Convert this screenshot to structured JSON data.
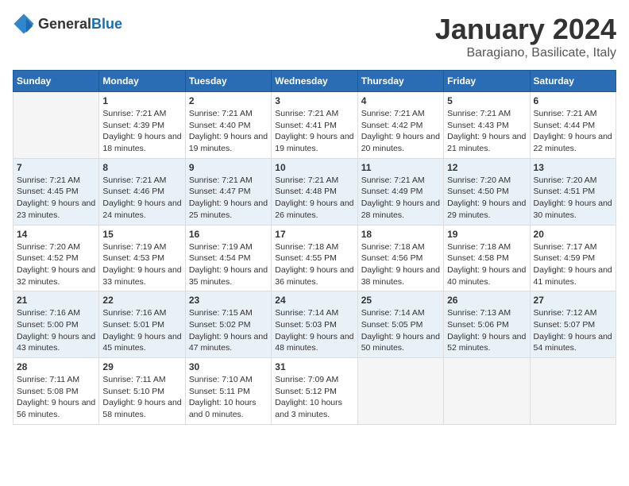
{
  "header": {
    "logo_general": "General",
    "logo_blue": "Blue",
    "main_title": "January 2024",
    "sub_title": "Baragiano, Basilicate, Italy"
  },
  "weekdays": [
    "Sunday",
    "Monday",
    "Tuesday",
    "Wednesday",
    "Thursday",
    "Friday",
    "Saturday"
  ],
  "weeks": [
    [
      {
        "day": "",
        "sunrise": "",
        "sunset": "",
        "daylight": ""
      },
      {
        "day": "1",
        "sunrise": "Sunrise: 7:21 AM",
        "sunset": "Sunset: 4:39 PM",
        "daylight": "Daylight: 9 hours and 18 minutes."
      },
      {
        "day": "2",
        "sunrise": "Sunrise: 7:21 AM",
        "sunset": "Sunset: 4:40 PM",
        "daylight": "Daylight: 9 hours and 19 minutes."
      },
      {
        "day": "3",
        "sunrise": "Sunrise: 7:21 AM",
        "sunset": "Sunset: 4:41 PM",
        "daylight": "Daylight: 9 hours and 19 minutes."
      },
      {
        "day": "4",
        "sunrise": "Sunrise: 7:21 AM",
        "sunset": "Sunset: 4:42 PM",
        "daylight": "Daylight: 9 hours and 20 minutes."
      },
      {
        "day": "5",
        "sunrise": "Sunrise: 7:21 AM",
        "sunset": "Sunset: 4:43 PM",
        "daylight": "Daylight: 9 hours and 21 minutes."
      },
      {
        "day": "6",
        "sunrise": "Sunrise: 7:21 AM",
        "sunset": "Sunset: 4:44 PM",
        "daylight": "Daylight: 9 hours and 22 minutes."
      }
    ],
    [
      {
        "day": "7",
        "sunrise": "Sunrise: 7:21 AM",
        "sunset": "Sunset: 4:45 PM",
        "daylight": "Daylight: 9 hours and 23 minutes."
      },
      {
        "day": "8",
        "sunrise": "Sunrise: 7:21 AM",
        "sunset": "Sunset: 4:46 PM",
        "daylight": "Daylight: 9 hours and 24 minutes."
      },
      {
        "day": "9",
        "sunrise": "Sunrise: 7:21 AM",
        "sunset": "Sunset: 4:47 PM",
        "daylight": "Daylight: 9 hours and 25 minutes."
      },
      {
        "day": "10",
        "sunrise": "Sunrise: 7:21 AM",
        "sunset": "Sunset: 4:48 PM",
        "daylight": "Daylight: 9 hours and 26 minutes."
      },
      {
        "day": "11",
        "sunrise": "Sunrise: 7:21 AM",
        "sunset": "Sunset: 4:49 PM",
        "daylight": "Daylight: 9 hours and 28 minutes."
      },
      {
        "day": "12",
        "sunrise": "Sunrise: 7:20 AM",
        "sunset": "Sunset: 4:50 PM",
        "daylight": "Daylight: 9 hours and 29 minutes."
      },
      {
        "day": "13",
        "sunrise": "Sunrise: 7:20 AM",
        "sunset": "Sunset: 4:51 PM",
        "daylight": "Daylight: 9 hours and 30 minutes."
      }
    ],
    [
      {
        "day": "14",
        "sunrise": "Sunrise: 7:20 AM",
        "sunset": "Sunset: 4:52 PM",
        "daylight": "Daylight: 9 hours and 32 minutes."
      },
      {
        "day": "15",
        "sunrise": "Sunrise: 7:19 AM",
        "sunset": "Sunset: 4:53 PM",
        "daylight": "Daylight: 9 hours and 33 minutes."
      },
      {
        "day": "16",
        "sunrise": "Sunrise: 7:19 AM",
        "sunset": "Sunset: 4:54 PM",
        "daylight": "Daylight: 9 hours and 35 minutes."
      },
      {
        "day": "17",
        "sunrise": "Sunrise: 7:18 AM",
        "sunset": "Sunset: 4:55 PM",
        "daylight": "Daylight: 9 hours and 36 minutes."
      },
      {
        "day": "18",
        "sunrise": "Sunrise: 7:18 AM",
        "sunset": "Sunset: 4:56 PM",
        "daylight": "Daylight: 9 hours and 38 minutes."
      },
      {
        "day": "19",
        "sunrise": "Sunrise: 7:18 AM",
        "sunset": "Sunset: 4:58 PM",
        "daylight": "Daylight: 9 hours and 40 minutes."
      },
      {
        "day": "20",
        "sunrise": "Sunrise: 7:17 AM",
        "sunset": "Sunset: 4:59 PM",
        "daylight": "Daylight: 9 hours and 41 minutes."
      }
    ],
    [
      {
        "day": "21",
        "sunrise": "Sunrise: 7:16 AM",
        "sunset": "Sunset: 5:00 PM",
        "daylight": "Daylight: 9 hours and 43 minutes."
      },
      {
        "day": "22",
        "sunrise": "Sunrise: 7:16 AM",
        "sunset": "Sunset: 5:01 PM",
        "daylight": "Daylight: 9 hours and 45 minutes."
      },
      {
        "day": "23",
        "sunrise": "Sunrise: 7:15 AM",
        "sunset": "Sunset: 5:02 PM",
        "daylight": "Daylight: 9 hours and 47 minutes."
      },
      {
        "day": "24",
        "sunrise": "Sunrise: 7:14 AM",
        "sunset": "Sunset: 5:03 PM",
        "daylight": "Daylight: 9 hours and 48 minutes."
      },
      {
        "day": "25",
        "sunrise": "Sunrise: 7:14 AM",
        "sunset": "Sunset: 5:05 PM",
        "daylight": "Daylight: 9 hours and 50 minutes."
      },
      {
        "day": "26",
        "sunrise": "Sunrise: 7:13 AM",
        "sunset": "Sunset: 5:06 PM",
        "daylight": "Daylight: 9 hours and 52 minutes."
      },
      {
        "day": "27",
        "sunrise": "Sunrise: 7:12 AM",
        "sunset": "Sunset: 5:07 PM",
        "daylight": "Daylight: 9 hours and 54 minutes."
      }
    ],
    [
      {
        "day": "28",
        "sunrise": "Sunrise: 7:11 AM",
        "sunset": "Sunset: 5:08 PM",
        "daylight": "Daylight: 9 hours and 56 minutes."
      },
      {
        "day": "29",
        "sunrise": "Sunrise: 7:11 AM",
        "sunset": "Sunset: 5:10 PM",
        "daylight": "Daylight: 9 hours and 58 minutes."
      },
      {
        "day": "30",
        "sunrise": "Sunrise: 7:10 AM",
        "sunset": "Sunset: 5:11 PM",
        "daylight": "Daylight: 10 hours and 0 minutes."
      },
      {
        "day": "31",
        "sunrise": "Sunrise: 7:09 AM",
        "sunset": "Sunset: 5:12 PM",
        "daylight": "Daylight: 10 hours and 3 minutes."
      },
      {
        "day": "",
        "sunrise": "",
        "sunset": "",
        "daylight": ""
      },
      {
        "day": "",
        "sunrise": "",
        "sunset": "",
        "daylight": ""
      },
      {
        "day": "",
        "sunrise": "",
        "sunset": "",
        "daylight": ""
      }
    ]
  ]
}
